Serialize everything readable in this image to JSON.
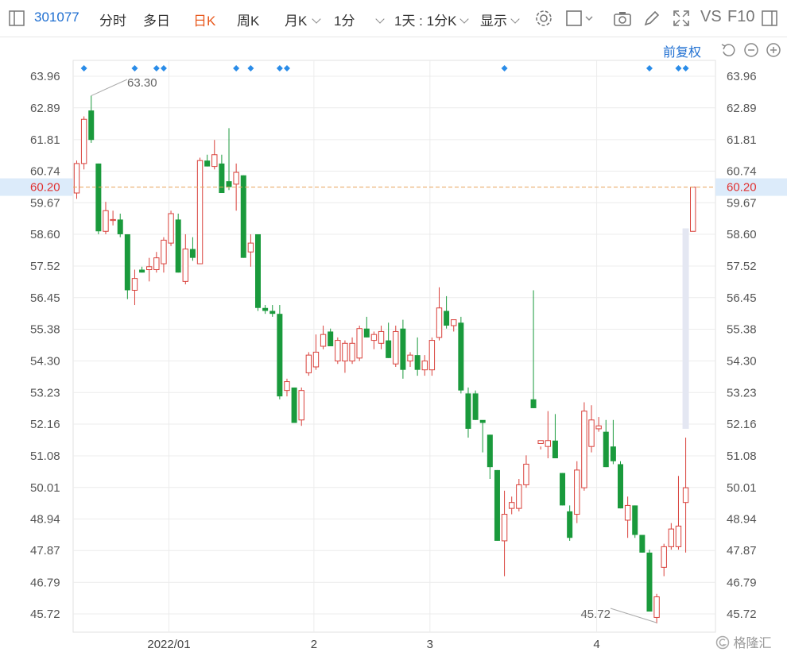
{
  "toolbar": {
    "code": "301077",
    "items": [
      "分时",
      "多日",
      "日K",
      "周K",
      "月K",
      "1分",
      "1天 : 1分K",
      "显示"
    ],
    "vs": "VS",
    "f10": "F10"
  },
  "fuquan": "前复权",
  "watermark": "格隆汇",
  "colors": {
    "up": "#d9413b",
    "down": "#1a9a3c",
    "accent": "#e8581c",
    "link": "#1f6fd1",
    "current": "#e03030"
  },
  "chart_data": {
    "type": "candlestick",
    "ylim": [
      45.1,
      64.5
    ],
    "y_ticks": [
      "63.96",
      "62.89",
      "61.81",
      "60.74",
      "59.67",
      "58.60",
      "57.52",
      "56.45",
      "55.38",
      "54.30",
      "53.23",
      "52.16",
      "51.08",
      "50.01",
      "48.94",
      "47.87",
      "46.79",
      "45.72"
    ],
    "x_ticks": [
      {
        "label": "2022/01",
        "index": 13
      },
      {
        "label": "2",
        "index": 33
      },
      {
        "label": "3",
        "index": 49
      },
      {
        "label": "4",
        "index": 72
      }
    ],
    "current_price": "60.20",
    "annotations": [
      {
        "label": "63.30",
        "index": 2,
        "value": 63.3
      },
      {
        "label": "45.72",
        "index": 80,
        "value": 45.42
      }
    ],
    "event_marker_indices": [
      1,
      8,
      11,
      12,
      22,
      24,
      28,
      29,
      59,
      79,
      83,
      84
    ],
    "ohlc": [
      [
        60.0,
        61.1,
        59.8,
        61.0
      ],
      [
        61.0,
        62.6,
        60.8,
        62.5
      ],
      [
        62.8,
        63.3,
        61.7,
        61.8
      ],
      [
        61.0,
        61.0,
        58.6,
        58.7
      ],
      [
        58.7,
        59.7,
        58.6,
        59.4
      ],
      [
        59.1,
        59.4,
        58.9,
        59.1
      ],
      [
        59.1,
        59.3,
        58.5,
        58.6
      ],
      [
        58.6,
        58.6,
        56.4,
        56.7
      ],
      [
        56.7,
        57.4,
        56.2,
        57.1
      ],
      [
        57.4,
        57.5,
        57.3,
        57.3
      ],
      [
        57.4,
        57.8,
        57.0,
        57.5
      ],
      [
        57.4,
        58.0,
        57.3,
        57.8
      ],
      [
        57.6,
        58.5,
        57.3,
        58.4
      ],
      [
        58.3,
        59.4,
        58.2,
        59.3
      ],
      [
        59.1,
        59.3,
        57.3,
        57.3
      ],
      [
        57.0,
        58.6,
        56.9,
        58.1
      ],
      [
        58.1,
        58.5,
        57.7,
        57.8
      ],
      [
        57.6,
        61.2,
        57.6,
        61.1
      ],
      [
        61.1,
        61.3,
        60.9,
        60.9
      ],
      [
        60.9,
        61.8,
        60.8,
        61.3
      ],
      [
        61.0,
        61.3,
        60.0,
        60.0
      ],
      [
        60.4,
        62.2,
        60.1,
        60.2
      ],
      [
        60.3,
        61.0,
        59.4,
        60.7
      ],
      [
        60.6,
        60.6,
        57.8,
        57.8
      ],
      [
        58.0,
        58.6,
        57.5,
        58.3
      ],
      [
        58.6,
        58.6,
        56.0,
        56.1
      ],
      [
        56.1,
        56.2,
        55.9,
        56.0
      ],
      [
        56.0,
        56.2,
        55.8,
        55.9
      ],
      [
        55.9,
        56.2,
        53.0,
        53.1
      ],
      [
        53.3,
        53.7,
        53.1,
        53.6
      ],
      [
        53.4,
        53.4,
        52.2,
        52.2
      ],
      [
        52.3,
        53.4,
        52.1,
        53.3
      ],
      [
        53.9,
        54.6,
        53.8,
        54.5
      ],
      [
        54.1,
        55.2,
        54.0,
        54.6
      ],
      [
        54.8,
        55.5,
        54.7,
        55.2
      ],
      [
        55.3,
        55.4,
        54.8,
        54.8
      ],
      [
        54.3,
        55.1,
        54.2,
        55.0
      ],
      [
        54.3,
        55.0,
        53.9,
        54.9
      ],
      [
        54.3,
        55.1,
        54.2,
        54.9
      ],
      [
        54.4,
        55.5,
        54.3,
        55.4
      ],
      [
        55.4,
        55.8,
        55.1,
        55.1
      ],
      [
        55.0,
        55.3,
        54.7,
        55.2
      ],
      [
        54.9,
        55.5,
        54.7,
        55.3
      ],
      [
        55.0,
        55.6,
        54.4,
        54.4
      ],
      [
        54.2,
        55.5,
        54.1,
        55.3
      ],
      [
        55.4,
        55.7,
        53.7,
        54.0
      ],
      [
        54.3,
        54.6,
        54.1,
        54.5
      ],
      [
        54.5,
        55.1,
        53.8,
        54.0
      ],
      [
        54.0,
        54.5,
        53.8,
        54.3
      ],
      [
        54.0,
        55.1,
        53.8,
        55.0
      ],
      [
        55.1,
        56.8,
        55.0,
        56.1
      ],
      [
        56.0,
        56.5,
        55.4,
        55.5
      ],
      [
        55.5,
        55.6,
        55.3,
        55.7
      ],
      [
        55.6,
        55.8,
        53.2,
        53.3
      ],
      [
        53.2,
        53.4,
        51.7,
        52.0
      ],
      [
        53.2,
        53.3,
        52.3,
        52.3
      ],
      [
        52.3,
        52.2,
        51.2,
        52.2
      ],
      [
        51.8,
        51.8,
        50.3,
        50.7
      ],
      [
        50.6,
        50.6,
        48.2,
        48.2
      ],
      [
        48.2,
        49.9,
        47.0,
        49.1
      ],
      [
        49.3,
        49.7,
        49.1,
        49.5
      ],
      [
        49.3,
        50.3,
        49.2,
        50.1
      ],
      [
        50.1,
        51.1,
        50.0,
        50.8
      ],
      [
        53.0,
        56.7,
        52.7,
        52.7
      ],
      [
        51.5,
        51.3,
        51.4,
        51.6
      ],
      [
        51.4,
        52.6,
        51.0,
        51.6
      ],
      [
        51.6,
        52.5,
        51.1,
        51.0
      ],
      [
        50.5,
        50.5,
        49.4,
        49.4
      ],
      [
        49.2,
        49.4,
        48.2,
        48.3
      ],
      [
        49.1,
        50.9,
        48.8,
        50.6
      ],
      [
        50.0,
        52.9,
        49.9,
        52.6
      ],
      [
        51.4,
        52.8,
        51.2,
        52.3
      ],
      [
        52.0,
        52.4,
        51.9,
        52.1
      ],
      [
        51.9,
        52.3,
        50.7,
        50.7
      ],
      [
        51.4,
        52.3,
        50.8,
        50.9
      ],
      [
        50.8,
        50.9,
        49.3,
        49.3
      ],
      [
        48.9,
        49.7,
        48.3,
        49.4
      ],
      [
        49.4,
        49.4,
        48.3,
        48.4
      ],
      [
        48.4,
        48.4,
        47.8,
        47.8
      ],
      [
        47.8,
        47.9,
        45.8,
        45.8
      ],
      [
        45.6,
        46.4,
        45.4,
        46.3
      ],
      [
        47.3,
        48.1,
        47.0,
        48.0
      ],
      [
        48.0,
        48.8,
        47.9,
        48.6
      ],
      [
        48.0,
        50.4,
        47.9,
        48.7
      ],
      [
        49.5,
        51.7,
        47.8,
        50.0
      ],
      [
        58.7,
        60.2,
        58.7,
        60.2
      ]
    ],
    "overlay_bar": {
      "index": 84,
      "from": 52.0,
      "to": 58.8,
      "color": "#e4e7f2"
    }
  }
}
